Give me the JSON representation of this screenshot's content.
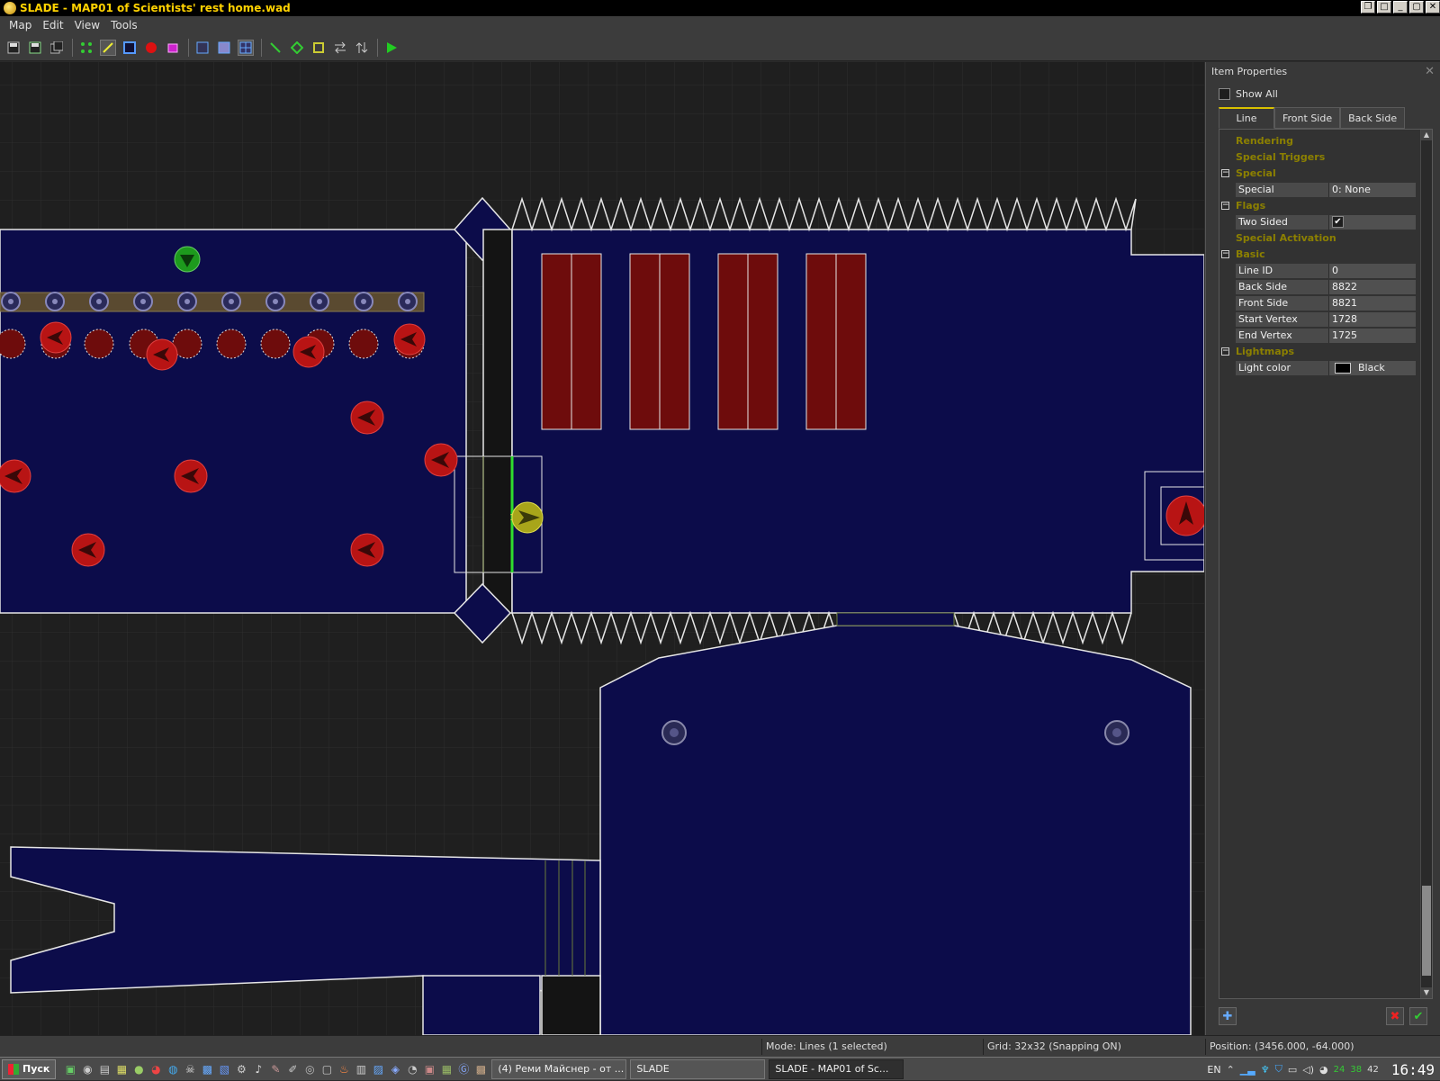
{
  "window": {
    "title": "SLADE - MAP01 of Scientists' rest home.wad"
  },
  "menu": [
    "Map",
    "Edit",
    "View",
    "Tools"
  ],
  "map_labels": {
    "selected_line_index": "1"
  },
  "props": {
    "header": "Item Properties",
    "show_all": "Show All",
    "tabs": [
      "Line",
      "Front Side",
      "Back Side"
    ],
    "categories": {
      "rendering": "Rendering",
      "special_triggers": "Special Triggers",
      "special": "Special",
      "flags": "Flags",
      "special_activation": "Special Activation",
      "basic": "Basic",
      "lightmaps": "Lightmaps"
    },
    "fields": {
      "special": {
        "k": "Special",
        "v": "0: None"
      },
      "two_sided": {
        "k": "Two Sided",
        "v": "✔"
      },
      "line_id": {
        "k": "Line ID",
        "v": "0"
      },
      "back_side": {
        "k": "Back Side",
        "v": "8822"
      },
      "front_side": {
        "k": "Front Side",
        "v": "8821"
      },
      "start_vertex": {
        "k": "Start Vertex",
        "v": "1728"
      },
      "end_vertex": {
        "k": "End Vertex",
        "v": "1725"
      },
      "light_color": {
        "k": "Light color",
        "v": "Black"
      }
    }
  },
  "status": {
    "mode": "Mode: Lines (1 selected)",
    "grid": "Grid: 32x32 (Snapping ON)",
    "position": "Position: (3456.000, -64.000)"
  },
  "taskbar": {
    "start": "Пуск",
    "tasks": [
      "(4) Реми Майснер - от ...",
      "SLADE",
      "SLADE - MAP01 of Sc..."
    ],
    "lang": "EN",
    "tray_nums": [
      "24",
      "38",
      "42"
    ],
    "clock": "16:49"
  },
  "colors": {
    "title": "#ffd200",
    "sector": "#0c0c4a",
    "line": "#e6e6e6",
    "category": "#8c8000",
    "selection": "#2fdc2f"
  }
}
